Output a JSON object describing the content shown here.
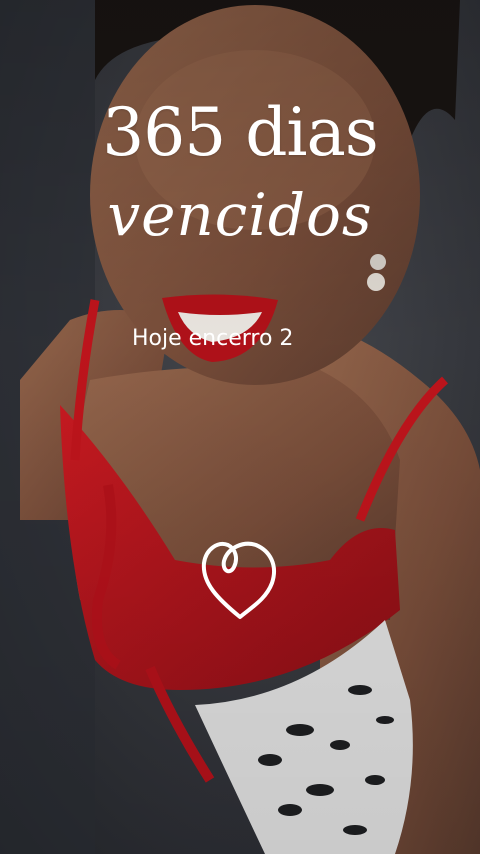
{
  "story": {
    "title": "365 dias",
    "title_script": "vencidos",
    "subtitle": "Hoje encerro 2",
    "decoration_icon": "heart-outline-icon"
  },
  "colors": {
    "text": "#ffffff",
    "top_red": "#c6151d",
    "background": "#2a2c33"
  }
}
